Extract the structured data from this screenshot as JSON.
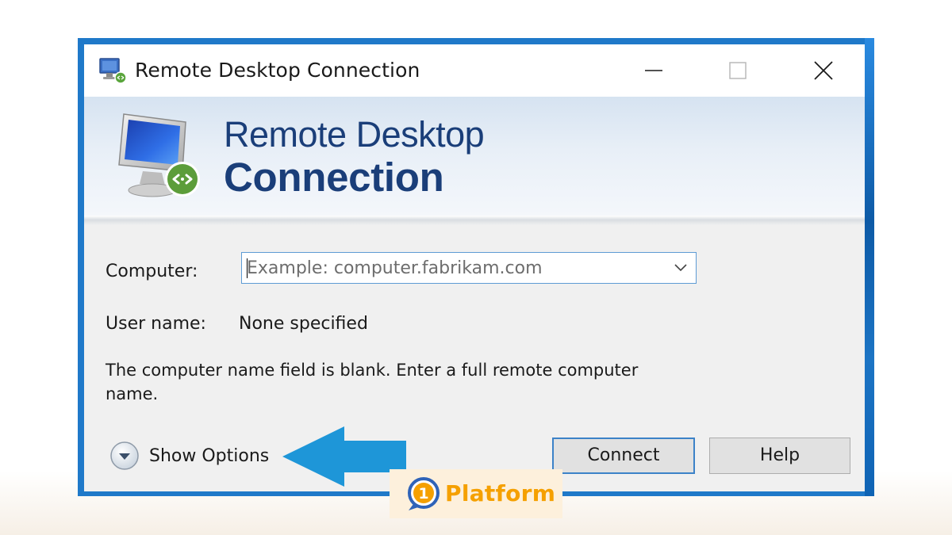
{
  "window": {
    "title": "Remote Desktop Connection",
    "controls": [
      "minimize",
      "maximize",
      "close"
    ]
  },
  "banner": {
    "line1": "Remote Desktop",
    "line2": "Connection"
  },
  "form": {
    "computer_label": "Computer:",
    "computer_placeholder": "Example: computer.fabrikam.com",
    "computer_value": "",
    "user_label": "User name:",
    "user_value": "None specified",
    "message": "The computer name field is blank. Enter a full remote computer name."
  },
  "footer": {
    "show_options_label": "Show Options",
    "connect_label": "Connect",
    "help_label": "Help"
  },
  "overlay": {
    "arrow_color": "#1e96d8",
    "logo_text": "Platform",
    "logo_badge": "1",
    "logo_color": "#f5a000"
  },
  "colors": {
    "frame": "#1f79c9",
    "banner_text": "#1a3e79",
    "input_border": "#5d9bd4",
    "default_button_border": "#3c82c8"
  },
  "icons": {
    "title": "remote-desktop-icon",
    "banner": "remote-desktop-monitor-icon",
    "dropdown": "chevron-down-icon",
    "options": "expand-circle-icon"
  }
}
